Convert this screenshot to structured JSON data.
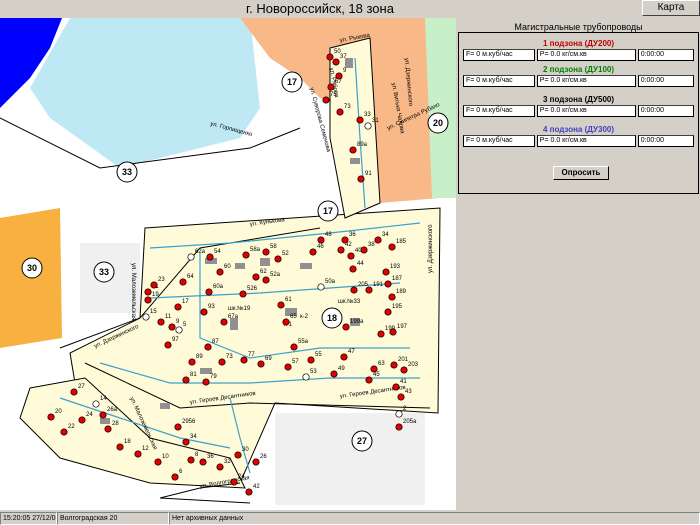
{
  "header": {
    "title": "г. Новороссийск, 18 зона",
    "map_button": "Карта"
  },
  "panel": {
    "title": "Магистральные трубопроводы",
    "poll_button": "Опросить",
    "zones": [
      {
        "label": "1 подзона (ДУ200)",
        "color": "#c00000",
        "flow": "F= 0 м.куб/час",
        "pressure": "P= 0.0 кг/см.кв",
        "time": "0:00:00"
      },
      {
        "label": "2 подзона (ДУ100)",
        "color": "#008000",
        "flow": "F= 0 м.куб/час",
        "pressure": "P= 0.0 кг/см.кв",
        "time": "0:00:00"
      },
      {
        "label": "3 подзона (ДУ500)",
        "color": "#000000",
        "flow": "F= 0 м.куб/час",
        "pressure": "P= 0.0 кг/см.кв",
        "time": "0:00:00"
      },
      {
        "label": "4 подзона (ДУ300)",
        "color": "#4040c0",
        "flow": "F= 0 м.куб/час",
        "pressure": "P= 0.0 кг/см.кв",
        "time": "0:00:00"
      }
    ]
  },
  "map": {
    "zones": [
      "17",
      "20",
      "33",
      "17",
      "30",
      "33",
      "18",
      "27"
    ],
    "streets": [
      "ул. Рыкова",
      "ул. Суворова Семенова",
      "ул. Рябова",
      "ул. Витька Чалова",
      "ул. Дзержинского",
      "ул. Скипетра Рубахо",
      "ул. Горпищенко",
      "ул. Кунькова",
      "ул. Малоземельская",
      "ул. Дзержинского",
      "ул. Героев Десантников",
      "ул. Героев Десантников",
      "ул. Малоземельская",
      "ул. Волгоградская",
      "ул. Дзержинского"
    ],
    "labels": [
      "шк.№19",
      "шк.№33",
      "к-1",
      "к-2"
    ],
    "buildings": [
      "50",
      "37",
      "9",
      "67",
      "75",
      "73",
      "33",
      "31",
      "89а",
      "91",
      "36",
      "48",
      "46",
      "42",
      "40",
      "38",
      "34",
      "185",
      "62а",
      "54",
      "52",
      "58а",
      "58",
      "60",
      "62",
      "64",
      "23",
      "21",
      "19",
      "15",
      "193",
      "187",
      "189",
      "191",
      "205",
      "195",
      "197",
      "199",
      "199а",
      "52а",
      "50а",
      "44",
      "60а",
      "17",
      "526",
      "93",
      "67а",
      "61",
      "65",
      "11",
      "9",
      "5",
      "97",
      "87",
      "89",
      "81",
      "79",
      "73",
      "77",
      "69",
      "55а",
      "57",
      "53",
      "55",
      "47",
      "63",
      "201",
      "203",
      "49",
      "45",
      "41",
      "43",
      "27",
      "14",
      "26а",
      "24",
      "22",
      "20",
      "28",
      "18",
      "12",
      "10",
      "6",
      "8",
      "2",
      "205а",
      "2956",
      "34",
      "36",
      "32",
      "30",
      "26",
      "24",
      "42",
      "44"
    ]
  },
  "status": {
    "time": "15:20:05 27/12/05",
    "street": "Волгоградская 20",
    "message": "Нет архивных данных"
  }
}
